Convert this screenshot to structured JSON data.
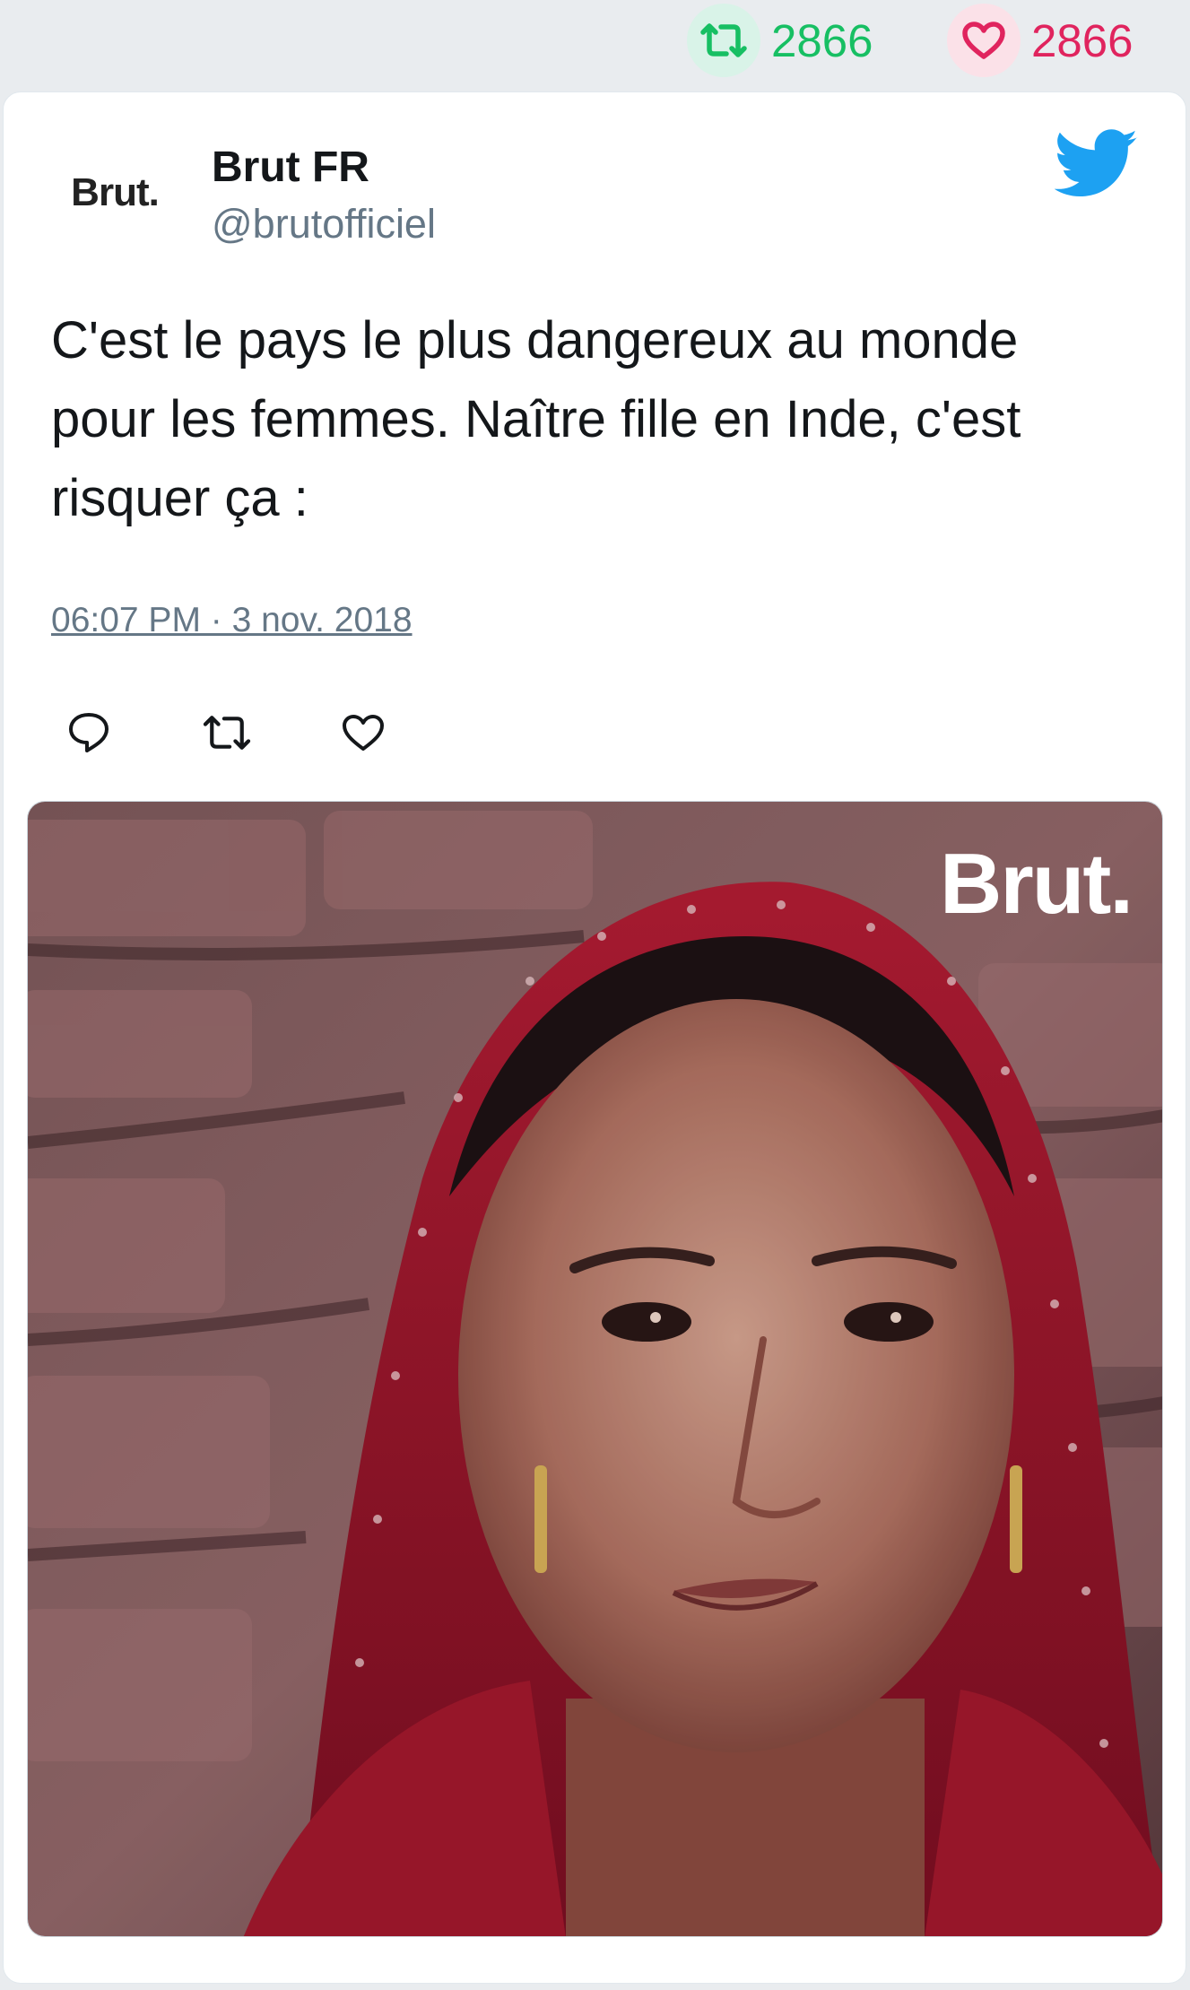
{
  "stats": {
    "retweet_count": "2866",
    "like_count": "2866"
  },
  "tweet": {
    "avatar_text": "Brut.",
    "display_name": "Brut FR",
    "handle": "@brutofficiel",
    "text": "C'est le pays le plus dangereux au monde pour les femmes. Naître fille en Inde, c'est risquer ça :",
    "timestamp": "06:07 PM · 3 nov. 2018"
  },
  "media": {
    "watermark": "Brut."
  },
  "icons": {
    "retweet": "retweet-icon",
    "like": "heart-icon",
    "reply": "reply-icon",
    "brand": "twitter-bird-icon"
  },
  "colors": {
    "retweet": "#17bf63",
    "like": "#e0245e",
    "twitter_blue": "#1da1f2",
    "secondary_text": "#657786"
  }
}
